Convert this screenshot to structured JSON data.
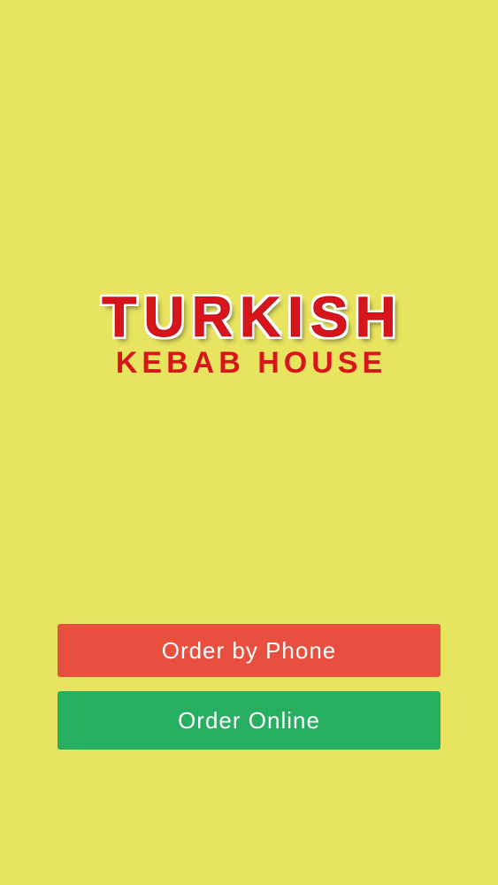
{
  "logo": {
    "title": "TURKISH",
    "subtitle": "KEBAB HOUSE"
  },
  "actions": {
    "phone_label": "Order by Phone",
    "online_label": "Order Online"
  },
  "colors": {
    "background": "#e8e460",
    "brand_red": "#d9151c",
    "phone_button": "#e84f3e",
    "online_button": "#27ae60"
  }
}
